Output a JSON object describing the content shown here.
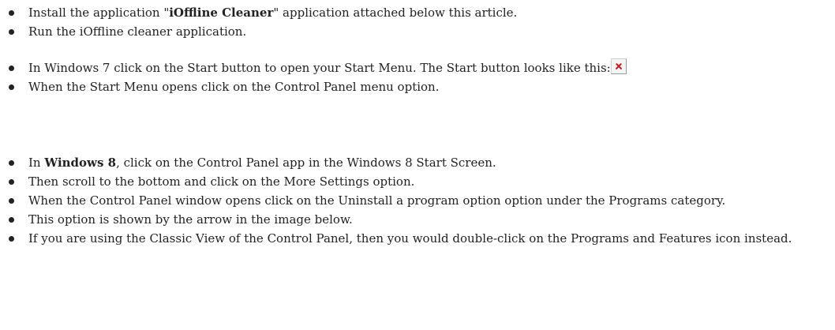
{
  "group1": {
    "step1": {
      "before": "Install the application \"",
      "bold": "iOffline Cleaner",
      "after": "\" application attached below this article."
    },
    "step2": "Run the iOffline cleaner application."
  },
  "group2": {
    "step1": "In Windows 7 click on the Start button to open your Start Menu. The Start button looks like this:",
    "step2": "When the Start Menu opens click on the Control Panel menu option."
  },
  "group3": {
    "step1": {
      "before": "In ",
      "bold": "Windows 8",
      "after": ", click on the Control Panel app in the Windows 8 Start Screen."
    },
    "step2": "Then scroll to the bottom and click on the More Settings option.",
    "step3": "When the Control Panel window opens click on the Uninstall a program option option under the Programs category.",
    "step4": "This option is shown by the arrow in the image below.",
    "step5": "If you are using the Classic View of the Control Panel, then you would double-click on the Programs and Features icon instead."
  },
  "icons": {
    "start_button_image": "broken-image-icon"
  }
}
